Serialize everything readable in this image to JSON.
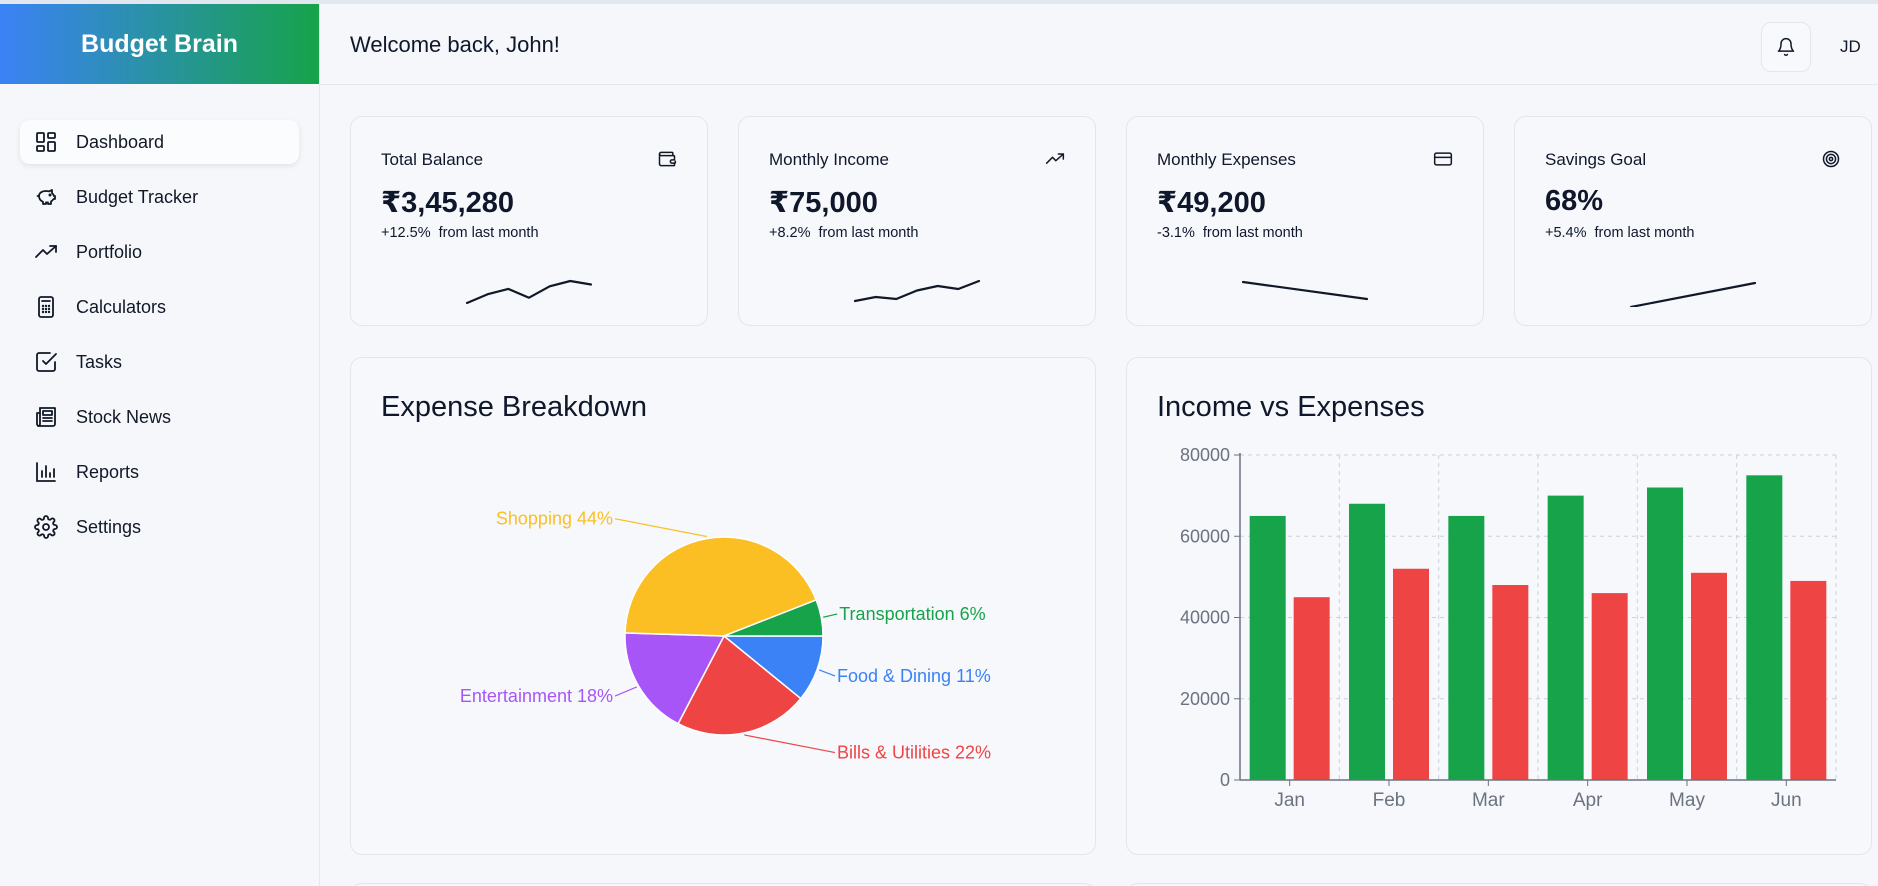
{
  "app": {
    "brand": "Budget Brain"
  },
  "sidebar": {
    "items": [
      {
        "label": "Dashboard",
        "icon": "dashboard-icon",
        "active": true
      },
      {
        "label": "Budget Tracker",
        "icon": "piggy-bank-icon"
      },
      {
        "label": "Portfolio",
        "icon": "trending-up-icon"
      },
      {
        "label": "Calculators",
        "icon": "calculator-icon"
      },
      {
        "label": "Tasks",
        "icon": "checkbox-icon"
      },
      {
        "label": "Stock News",
        "icon": "newspaper-icon"
      },
      {
        "label": "Reports",
        "icon": "bar-chart-icon"
      },
      {
        "label": "Settings",
        "icon": "gear-icon"
      }
    ]
  },
  "header": {
    "welcome": "Welcome back, John!",
    "user_initials": "JD",
    "notification_icon": "bell-icon"
  },
  "stats": [
    {
      "label": "Total Balance",
      "value": "₹3,45,280",
      "change": "+12.5%",
      "suffix": "from last month",
      "icon": "wallet-icon"
    },
    {
      "label": "Monthly Income",
      "value": "₹75,000",
      "change": "+8.2%",
      "suffix": "from last month",
      "icon": "trending-up-icon"
    },
    {
      "label": "Monthly Expenses",
      "value": "₹49,200",
      "change": "-3.1%",
      "suffix": "from last month",
      "icon": "credit-card-icon"
    },
    {
      "label": "Savings Goal",
      "value": "68%",
      "change": "+5.4%",
      "suffix": "from last month",
      "icon": "target-icon"
    }
  ],
  "expense_breakdown": {
    "title": "Expense Breakdown"
  },
  "income_vs_expenses": {
    "title": "Income vs Expenses"
  },
  "colors": {
    "income": "#16a34a",
    "expense": "#ef4444",
    "food": "#3b82f6",
    "transport": "#16a34a",
    "shopping": "#fbbf24",
    "entertainment": "#a855f7",
    "bills": "#ef4444"
  },
  "chart_data": [
    {
      "type": "line",
      "name": "Total Balance trend",
      "values": [
        1.0,
        3.0,
        4.2,
        2.2,
        4.8,
        6.0,
        5.2
      ]
    },
    {
      "type": "line",
      "name": "Monthly Income trend",
      "values": [
        1.0,
        1.8,
        1.4,
        3.1,
        4.0,
        3.4,
        5.0
      ]
    },
    {
      "type": "line",
      "name": "Monthly Expenses trend",
      "values": [
        5.0,
        1.0
      ]
    },
    {
      "type": "line",
      "name": "Savings Goal trend",
      "values": [
        1.0,
        5.0
      ]
    },
    {
      "type": "pie",
      "title": "Expense Breakdown",
      "slices": [
        {
          "label": "Food & Dining",
          "value": 11
        },
        {
          "label": "Bills & Utilities",
          "value": 22
        },
        {
          "label": "Entertainment",
          "value": 18
        },
        {
          "label": "Shopping",
          "value": 44
        },
        {
          "label": "Transportation",
          "value": 6
        }
      ]
    },
    {
      "type": "bar",
      "title": "Income vs Expenses",
      "categories": [
        "Jan",
        "Feb",
        "Mar",
        "Apr",
        "May",
        "Jun"
      ],
      "series": [
        {
          "values": [
            65000,
            68000,
            65000,
            70000,
            72000,
            75000
          ]
        },
        {
          "values": [
            45000,
            52000,
            48000,
            46000,
            51000,
            49000
          ]
        }
      ],
      "ylim": [
        0,
        80000
      ],
      "yticks": [
        0,
        20000,
        40000,
        60000,
        80000
      ],
      "grid": true
    }
  ]
}
